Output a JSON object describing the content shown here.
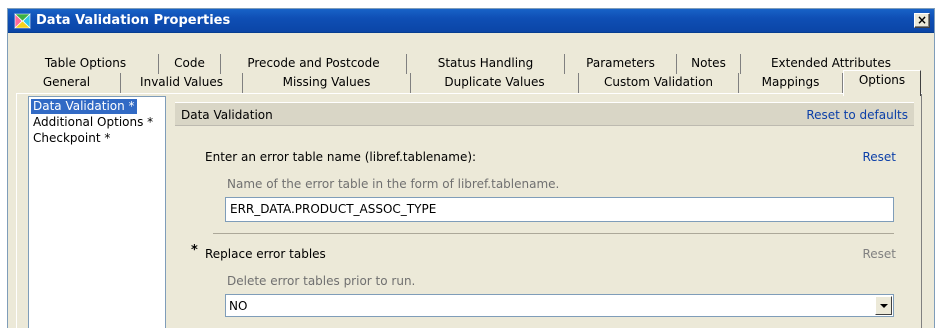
{
  "window": {
    "title": "Data Validation Properties",
    "close_label": "×"
  },
  "tabs": {
    "row1": [
      "Table Options",
      "Code",
      "Precode and Postcode",
      "Status Handling",
      "Parameters",
      "Notes",
      "Extended Attributes"
    ],
    "row2": [
      "General",
      "Invalid Values",
      "Missing Values",
      "Duplicate Values",
      "Custom Validation",
      "Mappings",
      "Options"
    ],
    "selected": "Options"
  },
  "nav": {
    "items": [
      "Data Validation *",
      "Additional Options *",
      "Checkpoint *"
    ],
    "selected": "Data Validation *"
  },
  "panel": {
    "title": "Data Validation",
    "reset_defaults": "Reset to defaults",
    "error_table": {
      "label": "Enter an error table name (libref.tablename):",
      "reset": "Reset",
      "description": "Name of the error table in the form of libref.tablename.",
      "value": "ERR_DATA.PRODUCT_ASSOC_TYPE"
    },
    "replace_tables": {
      "marker": "*",
      "label": "Replace error tables",
      "reset": "Reset",
      "description": "Delete error tables prior to run.",
      "value": "NO"
    }
  },
  "colors": {
    "titlebar": "#0b45a6",
    "selection": "#316ac5",
    "link": "#0b3fa8",
    "dialog_bg": "#ece9d8"
  }
}
